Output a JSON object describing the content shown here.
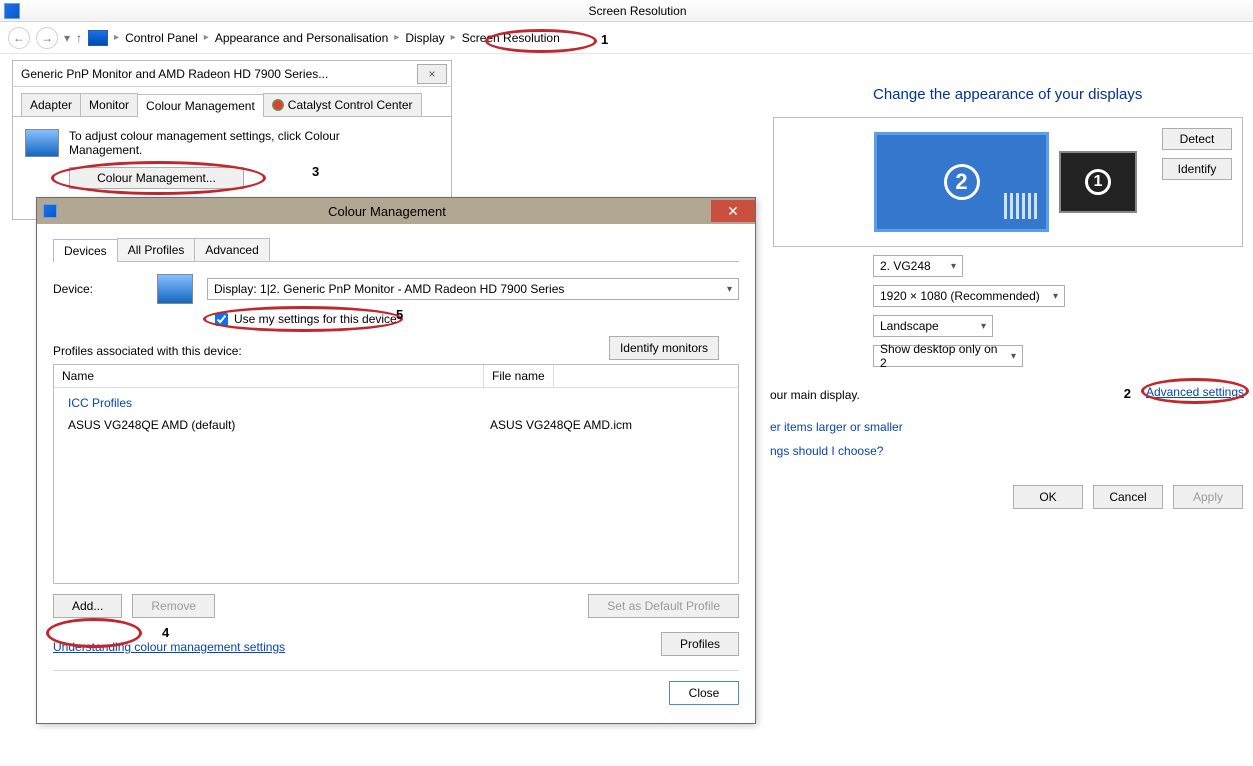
{
  "window": {
    "title": "Screen Resolution"
  },
  "breadcrumb": [
    "Control Panel",
    "Appearance and Personalisation",
    "Display",
    "Screen Resolution"
  ],
  "annotations": {
    "a1": "1",
    "a2": "2",
    "a3": "3",
    "a4": "4",
    "a5": "5"
  },
  "screenres": {
    "heading": "Change the appearance of your displays",
    "detect": "Detect",
    "identify": "Identify",
    "display_sel": "2. VG248",
    "resolution_sel": "1920 × 1080 (Recommended)",
    "orientation_sel": "Landscape",
    "multi_sel": "Show desktop only on 2",
    "trunc_main": "our main display.",
    "trunc_link1": "er items larger or smaller",
    "trunc_link2": "ngs should I choose?",
    "adv": "Advanced settings",
    "ok": "OK",
    "cancel": "Cancel",
    "apply": "Apply"
  },
  "prop": {
    "title": "Generic PnP Monitor and AMD Radeon HD 7900 Series...",
    "tabs": [
      "Adapter",
      "Monitor",
      "Colour Management",
      "Catalyst Control Center"
    ],
    "active_tab": 2,
    "desc": "To adjust colour management settings, click Colour Management.",
    "btn": "Colour Management..."
  },
  "cm": {
    "title": "Colour Management",
    "tabs": [
      "Devices",
      "All Profiles",
      "Advanced"
    ],
    "active_tab": 0,
    "device_label": "Device:",
    "device_sel": "Display: 1|2. Generic PnP Monitor - AMD Radeon HD 7900 Series",
    "use_checkbox": "Use my settings for this device",
    "identify_btn": "Identify monitors",
    "profiles_label": "Profiles associated with this device:",
    "col_name": "Name",
    "col_file": "File name",
    "group": "ICC Profiles",
    "profile_name": "ASUS VG248QE AMD (default)",
    "profile_file": "ASUS VG248QE AMD.icm",
    "add": "Add...",
    "remove": "Remove",
    "setdef": "Set as Default Profile",
    "und": "Understanding colour management settings",
    "profiles_btn": "Profiles",
    "close": "Close"
  }
}
